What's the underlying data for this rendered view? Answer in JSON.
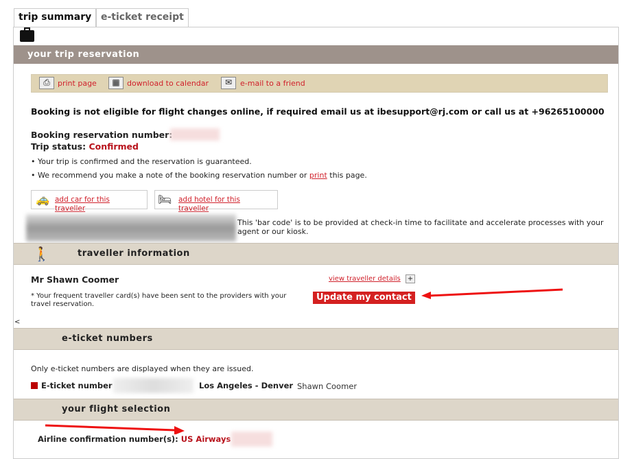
{
  "tabs": [
    {
      "label": "trip summary",
      "active": true
    },
    {
      "label": "e-ticket receipt",
      "active": false
    }
  ],
  "reservation": {
    "title": "your trip reservation",
    "actions": [
      {
        "icon": "printer-icon",
        "label": "print page"
      },
      {
        "icon": "calendar-add-icon",
        "label": "download to calendar"
      },
      {
        "icon": "envelope-icon",
        "label": "e-mail to a friend"
      }
    ],
    "notice": "Booking is not eligible for flight changes online, if required email us at ibesupport@rj.com or call us at +96265100000",
    "booking_label": "Booking reservation number:",
    "status_label": "Trip status:",
    "status": "Confirmed",
    "bullet1": "• Your trip is confirmed and the reservation is guaranteed.",
    "bullet2_pre": "• We recommend you make a note of the booking reservation number or ",
    "bullet2_link": "print",
    "bullet2_post": " this page.",
    "add_car": "add car for this traveller",
    "add_hotel": "add hotel for this traveller",
    "barcode_text": "This 'bar code' is to be provided at check-in time to facilitate and accelerate processes with your agent or our kiosk."
  },
  "traveller": {
    "title": "traveller information",
    "name": "Mr Shawn Coomer",
    "view_details": "view traveller details",
    "note": "* Your frequent traveller card(s) have been sent to the providers with your travel reservation.",
    "update_button": "Update my contact",
    "collapse": "<"
  },
  "eticket": {
    "title": "e-ticket numbers",
    "note": "Only e-ticket numbers are displayed when they are issued.",
    "label": "E-ticket number",
    "route": "Los Angeles - Denver",
    "passenger": "Shawn Coomer"
  },
  "flight": {
    "title": "your flight selection",
    "confirmation_label": "Airline confirmation number(s):",
    "airline": "US Airways"
  },
  "colors": {
    "accent": "#d0212b",
    "header_dark": "#9e928b",
    "header_light": "#ddd6c9",
    "action_bar": "#e0d4b4",
    "annotation_arrow": "#ee1111"
  }
}
